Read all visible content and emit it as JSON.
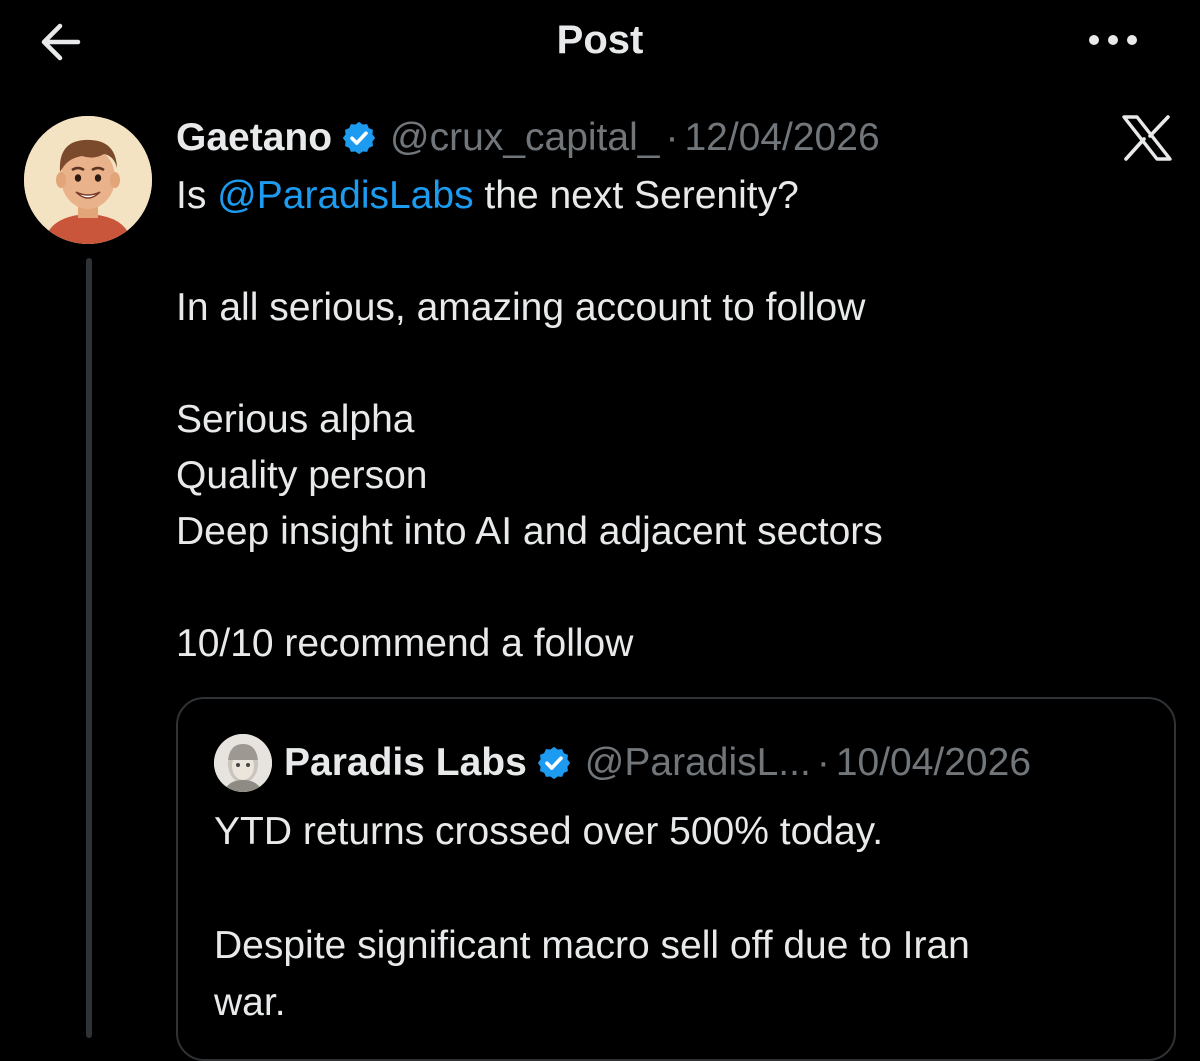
{
  "header": {
    "title": "Post",
    "back_icon": "arrow-left-icon",
    "more_icon": "ellipsis-icon"
  },
  "post": {
    "author": {
      "display_name": "Gaetano",
      "handle": "@crux_capital_",
      "verified": true
    },
    "separator": "·",
    "timestamp": "12/04/2026",
    "text_lines": {
      "l1_prefix": "Is ",
      "l1_mention": "@ParadisLabs",
      "l1_suffix": " the next Serenity?",
      "l2": "In all serious, amazing account to follow",
      "l3": "Serious alpha",
      "l4": "Quality person",
      "l5": "Deep insight into AI and adjacent sectors",
      "l6": "10/10 recommend a follow"
    },
    "platform_icon": "x-logo-icon"
  },
  "quote": {
    "author": {
      "display_name": "Paradis Labs",
      "handle": "@ParadisL...",
      "verified": true
    },
    "separator": "·",
    "timestamp": "10/04/2026",
    "text_lines": {
      "l1": "YTD returns crossed over 500% today.",
      "l2": "Despite significant macro sell off due to Iran",
      "l3": "war."
    }
  },
  "colors": {
    "background": "#000000",
    "text_primary": "#e7e9ea",
    "text_secondary": "#71767b",
    "accent_link": "#1d9bf0",
    "border": "#2f3336"
  }
}
